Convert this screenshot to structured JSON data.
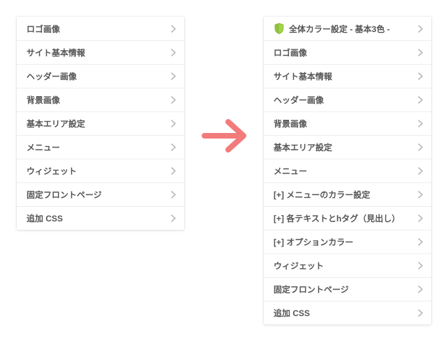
{
  "colors": {
    "arrow": "#f27b7b",
    "chevron": "#b9b9b9",
    "shield_fill": "#a5d24a",
    "shield_stroke": "#7cb518",
    "text": "#555555",
    "border": "#eeeeee"
  },
  "left_panel": {
    "items": [
      {
        "label": "ロゴ画像"
      },
      {
        "label": "サイト基本情報"
      },
      {
        "label": "ヘッダー画像"
      },
      {
        "label": "背景画像"
      },
      {
        "label": "基本エリア設定"
      },
      {
        "label": "メニュー"
      },
      {
        "label": "ウィジェット"
      },
      {
        "label": "固定フロントページ"
      },
      {
        "label": "追加 CSS"
      }
    ]
  },
  "right_panel": {
    "items": [
      {
        "label": "全体カラー設定 - 基本3色 -",
        "icon": "shield"
      },
      {
        "label": "ロゴ画像"
      },
      {
        "label": "サイト基本情報"
      },
      {
        "label": "ヘッダー画像"
      },
      {
        "label": "背景画像"
      },
      {
        "label": "基本エリア設定"
      },
      {
        "label": "メニュー"
      },
      {
        "label": "[+] メニューのカラー設定"
      },
      {
        "label": "[+] 各テキストとhタグ（見出し）"
      },
      {
        "label": "[+] オプションカラー"
      },
      {
        "label": "ウィジェット"
      },
      {
        "label": "固定フロントページ"
      },
      {
        "label": "追加 CSS"
      }
    ]
  }
}
